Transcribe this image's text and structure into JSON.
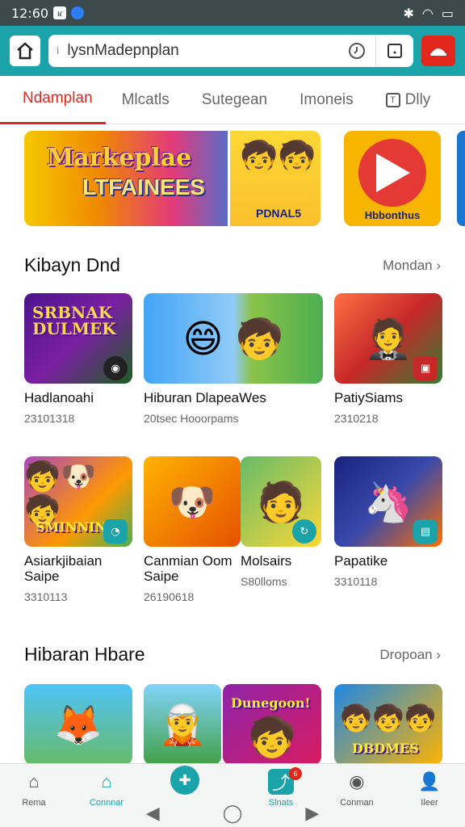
{
  "status_bar": {
    "time": "12:60",
    "icon1": "ʁ",
    "right_icons": [
      "bluetooth-icon",
      "wifi-icon",
      "battery-icon"
    ]
  },
  "browser": {
    "url": "lysnMadepnplan",
    "lock_icon": "i",
    "reload_icon": "ⓘ"
  },
  "tabs": [
    {
      "label": "Ndamplan"
    },
    {
      "label": "Mlcatls"
    },
    {
      "label": "Sutegean"
    },
    {
      "label": "Imoneis"
    },
    {
      "label": "Dlly",
      "icon": "T"
    }
  ],
  "banners": [
    {
      "line1": "Markeplae",
      "line2": "LTFAINEES",
      "label": "PDNAL5"
    },
    {
      "label": "Hbbonthus"
    }
  ],
  "section1": {
    "title": "Kibayn Dnd",
    "more": "Mondan",
    "cards": [
      {
        "art_text": "SRBNAK DULMEK",
        "name": "Hadlanoahi",
        "sub": "23101318"
      },
      {
        "name": "Hiburan DlapeaWes",
        "sub": "20tsec Hooorpams"
      },
      {
        "name": "PatiySiams",
        "sub": "2310218"
      }
    ]
  },
  "section2": {
    "cards": [
      {
        "art_text": "SMINNING",
        "name": "Asiarkjibaian Saipe",
        "sub": "3310113"
      },
      {
        "name": "Canmian Oom Saipe",
        "sub": "26190618"
      },
      {
        "name": "Molsairs",
        "sub": "S80lloms"
      },
      {
        "name": "Papatike",
        "sub": "3310118"
      }
    ]
  },
  "section3": {
    "title": "Hibaran Hbare",
    "more": "Dropoan",
    "cards": [
      {
        "name": ""
      },
      {
        "name": ""
      },
      {
        "art_text": "Dunegoon!"
      },
      {
        "art_text": "DBDMES"
      }
    ]
  },
  "bottom_nav": [
    {
      "label": "Rema"
    },
    {
      "label": "Connnar"
    },
    {
      "label": ""
    },
    {
      "label": "Slnats",
      "badge": "6"
    },
    {
      "label": "Conman"
    },
    {
      "label": "Ileer"
    }
  ],
  "colors": {
    "accent": "#1aa3a8",
    "brand_red": "#e1261c",
    "status_bar": "#3c4a4e"
  }
}
